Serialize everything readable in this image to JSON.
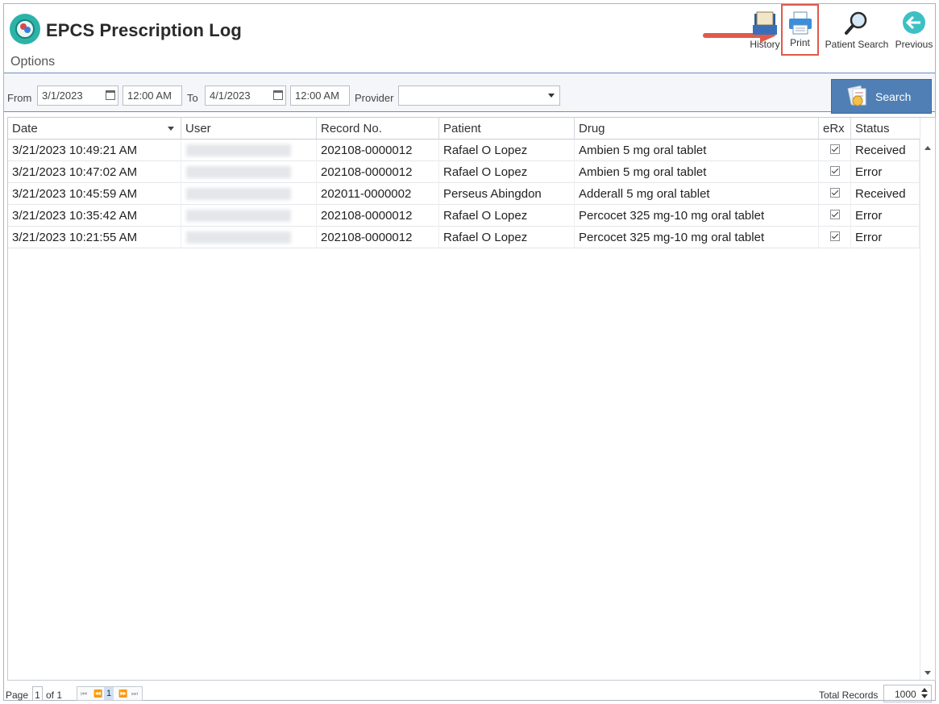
{
  "app": {
    "title": "EPCS Prescription Log",
    "section": "Options"
  },
  "toolbar": {
    "history_label": "History",
    "print_label": "Print",
    "patient_search_label": "Patient Search",
    "previous_label": "Previous"
  },
  "filters": {
    "from_label": "From",
    "from_date": "3/1/2023",
    "from_time": "12:00 AM",
    "to_label": "To",
    "to_date": "4/1/2023",
    "to_time": "12:00 AM",
    "provider_label": "Provider",
    "provider_value": "",
    "search_label": "Search"
  },
  "grid": {
    "columns": [
      "Date",
      "User",
      "Record No.",
      "Patient",
      "Drug",
      "eRx",
      "Status"
    ],
    "rows": [
      {
        "date": "3/21/2023 10:49:21 AM",
        "record": "202108-0000012",
        "patient": "Rafael O Lopez",
        "drug": "Ambien 5 mg oral tablet",
        "erx": true,
        "status": "Received"
      },
      {
        "date": "3/21/2023 10:47:02 AM",
        "record": "202108-0000012",
        "patient": "Rafael O Lopez",
        "drug": "Ambien 5 mg oral tablet",
        "erx": true,
        "status": "Error"
      },
      {
        "date": "3/21/2023 10:45:59 AM",
        "record": "202011-0000002",
        "patient": "Perseus Abingdon",
        "drug": "Adderall 5 mg oral tablet",
        "erx": true,
        "status": "Received"
      },
      {
        "date": "3/21/2023 10:35:42 AM",
        "record": "202108-0000012",
        "patient": "Rafael O Lopez",
        "drug": "Percocet 325 mg-10 mg oral tablet",
        "erx": true,
        "status": "Error"
      },
      {
        "date": "3/21/2023 10:21:55 AM",
        "record": "202108-0000012",
        "patient": "Rafael O Lopez",
        "drug": "Percocet 325 mg-10 mg oral tablet",
        "erx": true,
        "status": "Error"
      }
    ]
  },
  "footer": {
    "page_label": "Page",
    "page_value": "1",
    "of_label": "of 1",
    "current_page": "1",
    "total_records_label": "Total Records",
    "total_records_value": "1000"
  },
  "colors": {
    "accent": "#4f7fb5",
    "highlight": "#e05a4a",
    "logo": "#2bb3a8"
  }
}
